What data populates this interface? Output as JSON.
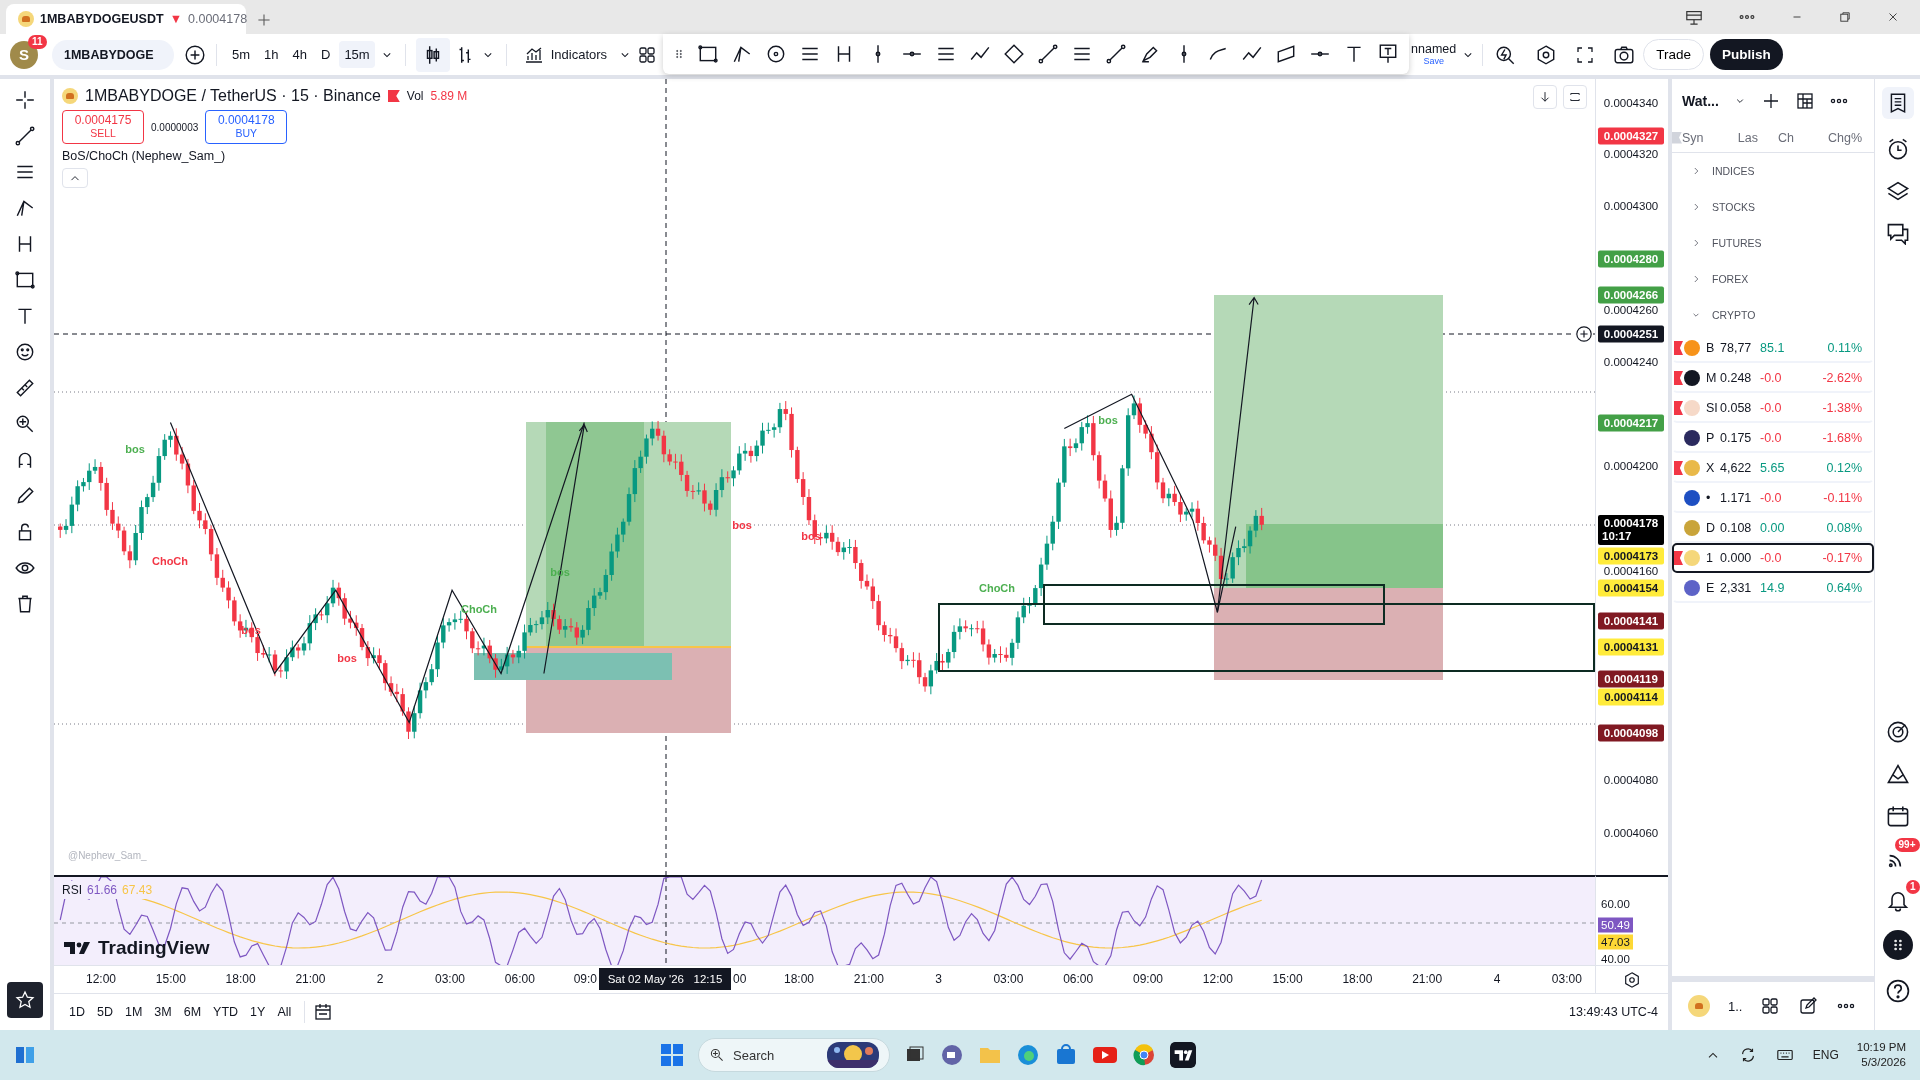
{
  "browser_tab": {
    "title": "1MBABYDOGEUSDT",
    "arrow": "▼",
    "price": "0.0004178"
  },
  "toolbar": {
    "avatar": "S",
    "avatar_badge": "11",
    "symbol": "1MBABYDOGE",
    "intervals": [
      {
        "label": "5m",
        "selected": false
      },
      {
        "label": "1h",
        "selected": false
      },
      {
        "label": "4h",
        "selected": false
      },
      {
        "label": "D",
        "selected": false
      },
      {
        "label": "15m",
        "selected": true
      }
    ],
    "indicators": "Indicators",
    "layout_name": "nnamed",
    "save": "Save",
    "trade": "Trade",
    "publish": "Publish"
  },
  "legend": {
    "title": "1MBABYDOGE / TetherUS · 15 · Binance",
    "vol_label": "Vol",
    "vol_value": "5.89 M",
    "sell_price": "0.0004175",
    "sell": "SELL",
    "spread": "0.0000003",
    "buy_price": "0.0004178",
    "buy": "BUY",
    "indicator": "BoS/ChoCh (Nephew_Sam_)"
  },
  "chart_labels": [
    {
      "text": "bos",
      "color": "#4caf50"
    },
    {
      "text": "ChoCh",
      "color": "#f23645"
    },
    {
      "text": "bos",
      "color": "#f23645"
    },
    {
      "text": "bos",
      "color": "#f23645"
    },
    {
      "text": "ChoCh",
      "color": "#4caf50"
    },
    {
      "text": "bos",
      "color": "#4caf50"
    },
    {
      "text": "bos",
      "color": "#f23645"
    },
    {
      "text": "bos",
      "color": "#f23645"
    },
    {
      "text": "ChoCh",
      "color": "#4caf50"
    },
    {
      "text": "bos",
      "color": "#4caf50"
    }
  ],
  "chart_watermark": "@Nephew_Sam_",
  "price_axis": [
    {
      "text": "0.0004340",
      "kind": "plain"
    },
    {
      "text": "0.0004327",
      "kind": "tag",
      "color": "#f23645"
    },
    {
      "text": "0.0004320",
      "kind": "plain"
    },
    {
      "text": "0.0004300",
      "kind": "plain"
    },
    {
      "text": "0.0004280",
      "kind": "tag",
      "color": "#43a047"
    },
    {
      "text": "0.0004266",
      "kind": "tag",
      "color": "#43a047"
    },
    {
      "text": "0.0004260",
      "kind": "plain"
    },
    {
      "text": "0.0004251",
      "kind": "tag",
      "color": "#131722"
    },
    {
      "text": "0.0004240",
      "kind": "plain"
    },
    {
      "text": "0.0004217",
      "kind": "tag",
      "color": "#43a047"
    },
    {
      "text": "0.0004200",
      "kind": "plain"
    },
    {
      "text": "0.0004178",
      "sub": "10:17",
      "kind": "tag",
      "color": "#000000"
    },
    {
      "text": "0.0004173",
      "kind": "tag",
      "color": "#ffeb3b"
    },
    {
      "text": "0.0004160",
      "kind": "plain"
    },
    {
      "text": "0.0004154",
      "kind": "tag",
      "color": "#ffeb3b"
    },
    {
      "text": "0.0004141",
      "kind": "tag",
      "color": "#801922"
    },
    {
      "text": "0.0004131",
      "kind": "tag",
      "color": "#ffeb3b"
    },
    {
      "text": "0.0004119",
      "kind": "tag",
      "color": "#801922"
    },
    {
      "text": "0.0004114",
      "kind": "tag",
      "color": "#ffeb3b"
    },
    {
      "text": "0.0004098",
      "kind": "tag",
      "color": "#801922"
    },
    {
      "text": "0.0004080",
      "kind": "plain"
    },
    {
      "text": "0.0004060",
      "kind": "plain"
    }
  ],
  "rsi": {
    "label": "RSI",
    "value": "61.66",
    "average": "67.43",
    "logo": "TradingView",
    "axis": [
      {
        "text": "60.00",
        "kind": "plain"
      },
      {
        "text": "50.49",
        "kind": "tag",
        "color": "#7e57c2"
      },
      {
        "text": "47.03",
        "kind": "tag",
        "color": "#fdd835"
      },
      {
        "text": "40.00",
        "kind": "plain"
      }
    ]
  },
  "time_axis": [
    "12:00",
    "15:00",
    "18:00",
    "21:00",
    "2",
    "03:00",
    "06:00",
    "09:0",
    "00",
    "18:00",
    "21:00",
    "3",
    "03:00",
    "06:00",
    "09:00",
    "12:00",
    "15:00",
    "18:00",
    "21:00",
    "4",
    "03:00"
  ],
  "crosshair_time": "Sat 02 May '26   12:15",
  "ranges": [
    "1D",
    "5D",
    "1M",
    "3M",
    "6M",
    "YTD",
    "1Y",
    "All"
  ],
  "clock": "13:49:43 UTC-4",
  "watchlist": {
    "title": "Wat...",
    "columns": [
      "Syn",
      "Las",
      "Ch",
      "Chg%"
    ],
    "groups": [
      {
        "name": "INDICES",
        "expanded": false
      },
      {
        "name": "STOCKS",
        "expanded": false
      },
      {
        "name": "FUTURES",
        "expanded": false
      },
      {
        "name": "FOREX",
        "expanded": false
      },
      {
        "name": "CRYPTO",
        "expanded": true,
        "children": [
          {
            "symbol": "B",
            "last": "78,77",
            "change": "85.1",
            "change_pct": "0.11%",
            "positive": true,
            "flagged": true,
            "selected": false,
            "color": "#f7931a"
          },
          {
            "symbol": "M",
            "last": "0.248",
            "change": "-0.0",
            "change_pct": "-2.62%",
            "positive": false,
            "flagged": true,
            "selected": false,
            "color": "#131722"
          },
          {
            "symbol": "SI",
            "last": "0.058",
            "change": "-0.0",
            "change_pct": "-1.38%",
            "positive": false,
            "flagged": true,
            "selected": false,
            "color": "#f6d9c8"
          },
          {
            "symbol": "P",
            "last": "0.175",
            "change": "-0.0",
            "change_pct": "-1.68%",
            "positive": false,
            "flagged": false,
            "selected": false,
            "color": "#2b2a5e"
          },
          {
            "symbol": "X",
            "last": "4,622",
            "change": "5.65",
            "change_pct": "0.12%",
            "positive": true,
            "flagged": true,
            "selected": false,
            "color": "#e9b949"
          },
          {
            "symbol": "•",
            "last": "1.171",
            "change": "-0.0",
            "change_pct": "-0.11%",
            "positive": false,
            "flagged": false,
            "selected": false,
            "color": "#1e4fc2"
          },
          {
            "symbol": "D",
            "last": "0.108",
            "change": "0.00",
            "change_pct": "0.08%",
            "positive": true,
            "flagged": false,
            "selected": false,
            "color": "#c9a43a"
          },
          {
            "symbol": "1",
            "last": "0.000",
            "change": "-0.0",
            "change_pct": "-0.17%",
            "positive": false,
            "flagged": true,
            "selected": true,
            "color": "#f5d77a"
          },
          {
            "symbol": "E",
            "last": "2,331",
            "change": "14.9",
            "change_pct": "0.64%",
            "positive": true,
            "flagged": false,
            "selected": false,
            "color": "#5d63c7"
          }
        ]
      }
    ],
    "footer_symbol": "1.."
  },
  "sidebar_badges": {
    "news": "99+",
    "alerts": "1"
  },
  "taskbar": {
    "search": "Search",
    "language": "ENG",
    "time": "10:19 PM",
    "date": "5/3/2026"
  }
}
